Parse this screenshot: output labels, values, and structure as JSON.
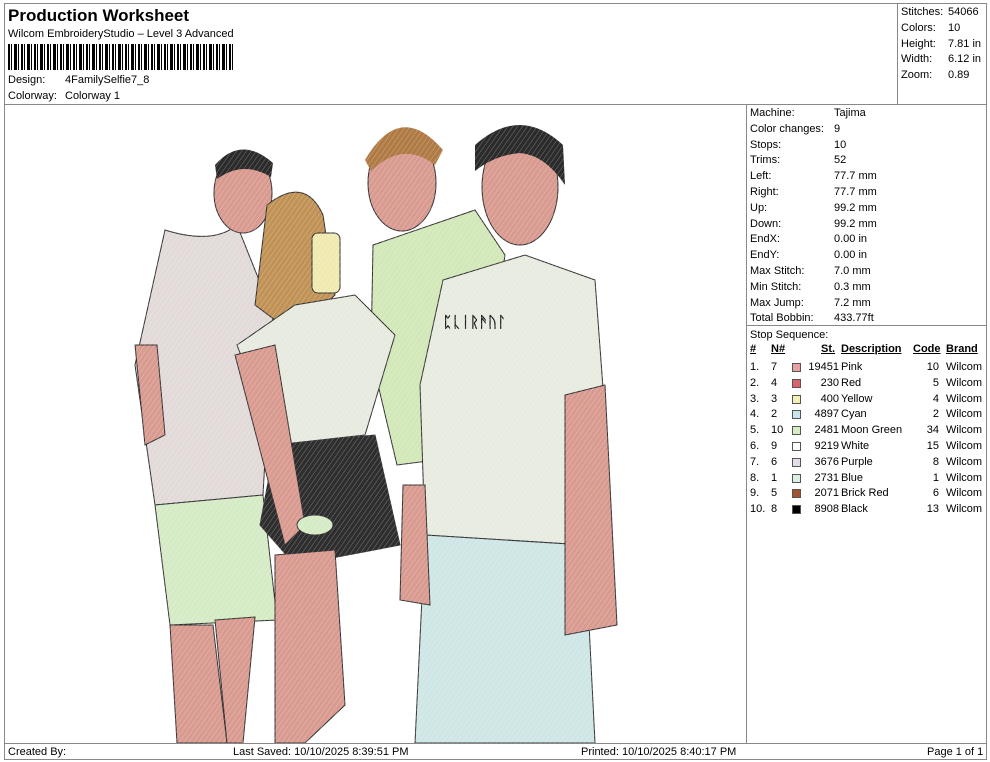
{
  "header": {
    "title": "Production Worksheet",
    "subtitle": "Wilcom EmbroideryStudio – Level 3 Advanced",
    "design_label": "Design:",
    "design_value": "4FamilySelfie7_8",
    "colorway_label": "Colorway:",
    "colorway_value": "Colorway 1"
  },
  "stats": [
    {
      "label": "Stitches:",
      "value": "54066"
    },
    {
      "label": "Colors:",
      "value": "10"
    },
    {
      "label": "Height:",
      "value": "7.81 in"
    },
    {
      "label": "Width:",
      "value": "6.12 in"
    },
    {
      "label": "Zoom:",
      "value": "0.89"
    }
  ],
  "machine": [
    {
      "label": "Machine:",
      "value": "Tajima"
    },
    {
      "label": "Color changes:",
      "value": "9"
    },
    {
      "label": "Stops:",
      "value": "10"
    },
    {
      "label": "Trims:",
      "value": "52"
    },
    {
      "label": "Left:",
      "value": "77.7 mm"
    },
    {
      "label": "Right:",
      "value": "77.7 mm"
    },
    {
      "label": "Up:",
      "value": "99.2 mm"
    },
    {
      "label": "Down:",
      "value": "99.2 mm"
    },
    {
      "label": "EndX:",
      "value": "0.00 in"
    },
    {
      "label": "EndY:",
      "value": "0.00 in"
    },
    {
      "label": "Max Stitch:",
      "value": "7.0 mm"
    },
    {
      "label": "Min Stitch:",
      "value": "0.3 mm"
    },
    {
      "label": "Max Jump:",
      "value": "7.2 mm"
    },
    {
      "label": "Total Bobbin:",
      "value": "433.77ft"
    }
  ],
  "stop_sequence": {
    "title": "Stop Sequence:",
    "headers": {
      "num": "#",
      "n": "N#",
      "st": "St.",
      "desc": "Description",
      "code": "Code",
      "brand": "Brand"
    },
    "rows": [
      {
        "num": "1.",
        "n": "7",
        "color": "#e8a0a0",
        "st": "19451",
        "desc": "Pink",
        "code": "10",
        "brand": "Wilcom"
      },
      {
        "num": "2.",
        "n": "4",
        "color": "#d9626b",
        "st": "230",
        "desc": "Red",
        "code": "5",
        "brand": "Wilcom"
      },
      {
        "num": "3.",
        "n": "3",
        "color": "#f4efb5",
        "st": "400",
        "desc": "Yellow",
        "code": "4",
        "brand": "Wilcom"
      },
      {
        "num": "4.",
        "n": "2",
        "color": "#c9e6ee",
        "st": "4897",
        "desc": "Cyan",
        "code": "2",
        "brand": "Wilcom"
      },
      {
        "num": "5.",
        "n": "10",
        "color": "#d6ecc4",
        "st": "2481",
        "desc": "Moon Green",
        "code": "34",
        "brand": "Wilcom"
      },
      {
        "num": "6.",
        "n": "9",
        "color": "#ffffff",
        "st": "9219",
        "desc": "White",
        "code": "15",
        "brand": "Wilcom"
      },
      {
        "num": "7.",
        "n": "6",
        "color": "#e4dde8",
        "st": "3676",
        "desc": "Purple",
        "code": "8",
        "brand": "Wilcom"
      },
      {
        "num": "8.",
        "n": "1",
        "color": "#d9f0e3",
        "st": "2731",
        "desc": "Blue",
        "code": "1",
        "brand": "Wilcom"
      },
      {
        "num": "9.",
        "n": "5",
        "color": "#a0552e",
        "st": "2071",
        "desc": "Brick Red",
        "code": "6",
        "brand": "Wilcom"
      },
      {
        "num": "10.",
        "n": "8",
        "color": "#000000",
        "st": "8908",
        "desc": "Black",
        "code": "13",
        "brand": "Wilcom"
      }
    ]
  },
  "footer": {
    "created_by": "Created By:",
    "last_saved": "Last Saved: 10/10/2025 8:39:51 PM",
    "printed": "Printed: 10/10/2025 8:40:17 PM",
    "page": "Page 1 of 1"
  },
  "design_art": {
    "shirt_text": "ᛈᚳᛁᚱᚫᚢᛚ"
  }
}
